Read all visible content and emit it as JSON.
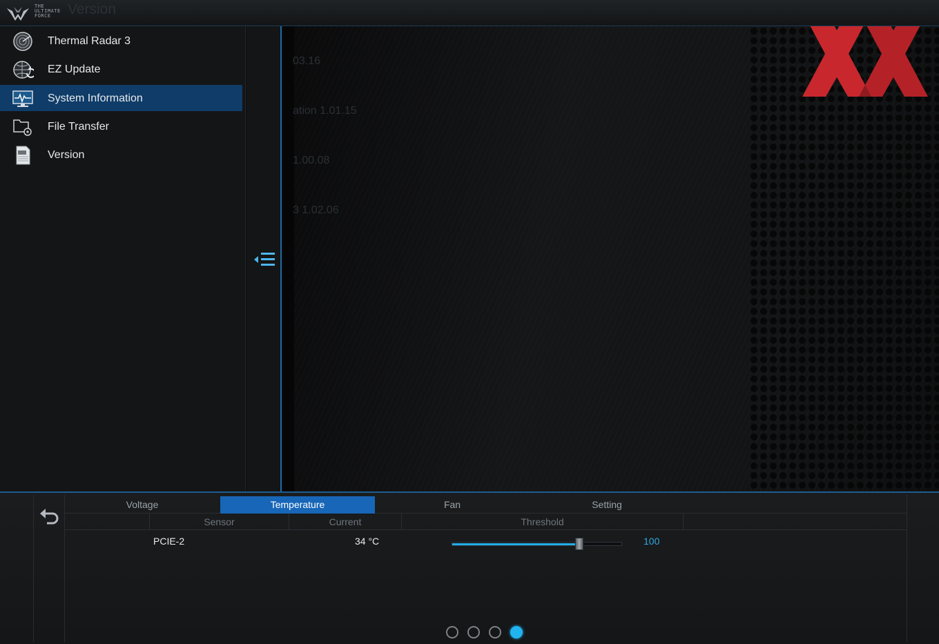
{
  "app": {
    "logo_lines": [
      "THE",
      "ULTIMATE",
      "FORCE"
    ],
    "title": "Version"
  },
  "sidebar": {
    "items": [
      {
        "label": "Thermal Radar 3",
        "icon": "thermal-radar-icon",
        "active": false
      },
      {
        "label": "EZ Update",
        "icon": "globe-update-icon",
        "active": false
      },
      {
        "label": "System Information",
        "icon": "system-monitor-icon",
        "active": true
      },
      {
        "label": "File Transfer",
        "icon": "file-transfer-icon",
        "active": false
      },
      {
        "label": "Version",
        "icon": "version-document-icon",
        "active": false
      }
    ]
  },
  "main": {
    "ghost_lines": [
      "03.16",
      "ation   1.01.15",
      "1.00.08",
      "3    1.02.06"
    ]
  },
  "thermal_panel": {
    "tabs": [
      {
        "label": "Voltage",
        "active": false
      },
      {
        "label": "Temperature",
        "active": true
      },
      {
        "label": "Fan",
        "active": false
      },
      {
        "label": "Setting",
        "active": false
      }
    ],
    "columns": {
      "sensor": "Sensor",
      "current": "Current",
      "threshold": "Threshold"
    },
    "rows": [
      {
        "sensor": "PCIE-2",
        "current": "34 °C",
        "threshold": "100",
        "threshold_fraction": 0.75
      }
    ],
    "pages": 4,
    "active_page": 4
  },
  "colors": {
    "accent": "#1766b8",
    "active_nav": "#0f3c68",
    "slider_fill": "#23aee8",
    "watermark": "#c8282d"
  }
}
